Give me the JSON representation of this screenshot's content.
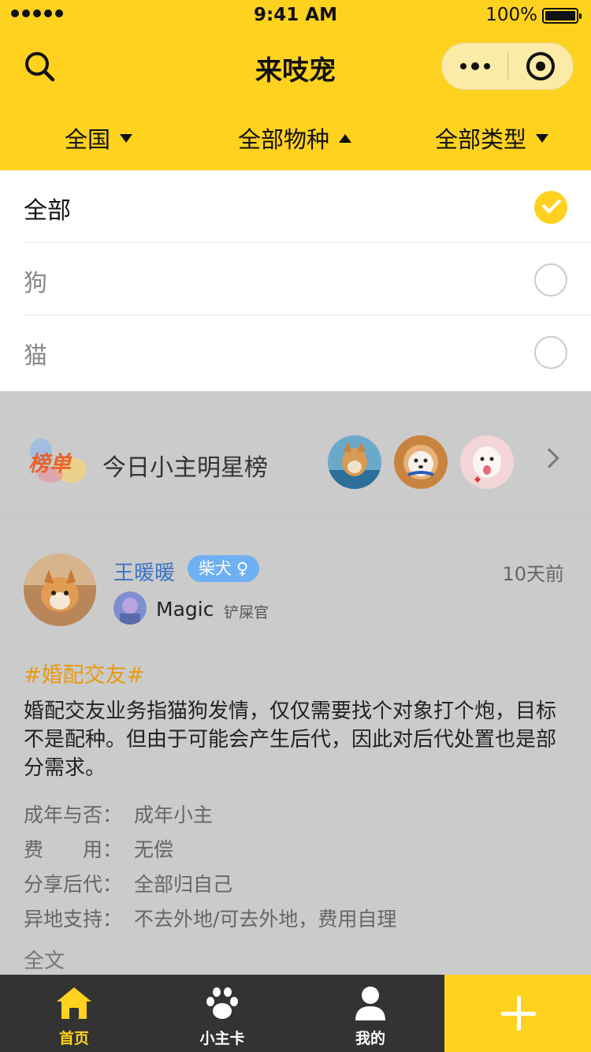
{
  "status_bar": {
    "time": "9:41 AM",
    "battery": "100%"
  },
  "nav": {
    "title": "来吱宠"
  },
  "filters": [
    {
      "label": "全国",
      "arrow": "down"
    },
    {
      "label": "全部物种",
      "arrow": "up"
    },
    {
      "label": "全部类型",
      "arrow": "down"
    }
  ],
  "dropdown": {
    "options": [
      {
        "label": "全部",
        "selected": true
      },
      {
        "label": "狗",
        "selected": false
      },
      {
        "label": "猫",
        "selected": false
      }
    ]
  },
  "ranking": {
    "badge_text": "榜单",
    "title": "今日小主明星榜"
  },
  "post": {
    "author": "王暖暖",
    "breed": "柴犬",
    "gender_symbol": "♀",
    "time_ago": "10天前",
    "owner_name": "Magic",
    "owner_role": "铲屎官",
    "hashtag": "#婚配交友#",
    "body": "婚配交友业务指猫狗发情，仅仅需要找个对象打个炮，目标不是配种。但由于可能会产生后代，因此对后代处置也是部分需求。",
    "details": [
      {
        "key": "成年与否：",
        "value": "成年小主"
      },
      {
        "key": "费　　用：",
        "value": "无偿"
      },
      {
        "key": "分享后代：",
        "value": "全部归自己"
      },
      {
        "key": "异地支持：",
        "value": "不去外地/可去外地，费用自理"
      }
    ],
    "more_label": "全文"
  },
  "tabbar": {
    "tabs": [
      {
        "label": "首页",
        "icon": "home-icon",
        "active": true
      },
      {
        "label": "小主卡",
        "icon": "paw-icon",
        "active": false
      },
      {
        "label": "我的",
        "icon": "user-icon",
        "active": false
      }
    ],
    "add_icon": "plus-icon"
  },
  "colors": {
    "accent": "#FFD21F",
    "link": "#3c73c6",
    "hashtag": "#E89A10",
    "tabbar_bg": "#333333"
  }
}
